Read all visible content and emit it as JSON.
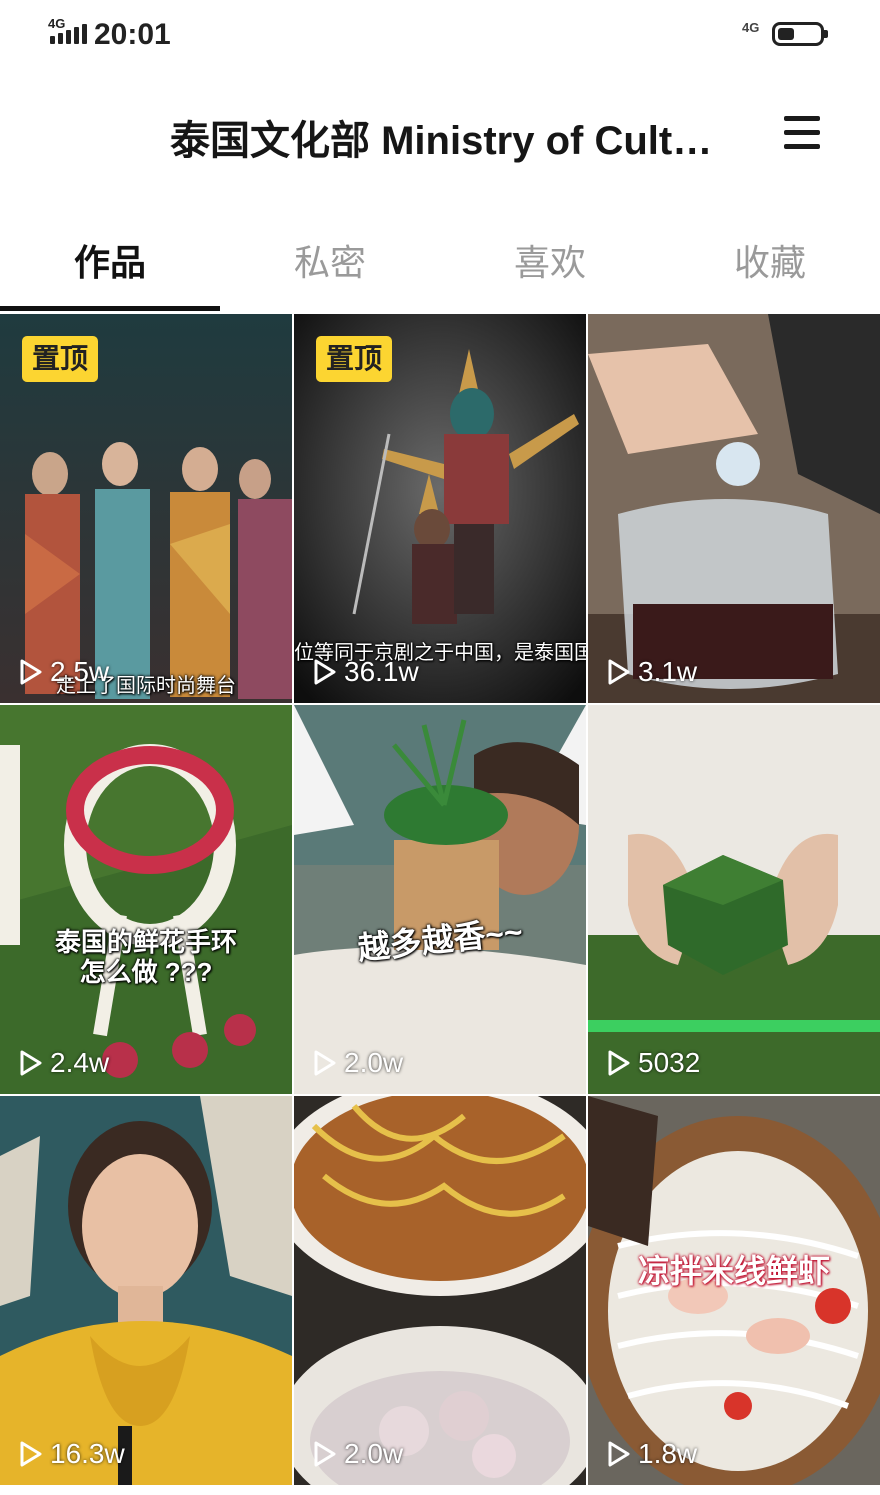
{
  "status_bar": {
    "network_left": "4G",
    "time": "20:01",
    "network_right": "4G",
    "battery_level_percent": 40
  },
  "header": {
    "title": "泰国文化部 Ministry of Cult…",
    "menu_icon": "hamburger-menu-icon"
  },
  "tabs": [
    {
      "label": "作品",
      "active": true
    },
    {
      "label": "私密",
      "active": false
    },
    {
      "label": "喜欢",
      "active": false
    },
    {
      "label": "收藏",
      "active": false
    }
  ],
  "videos": [
    {
      "pinned": "置顶",
      "views": "2.5w",
      "caption": "走上了国际时尚舞台",
      "scene": "fashion runway models"
    },
    {
      "pinned": "置顶",
      "views": "36.1w",
      "caption": "位等同于京剧之于中国，是泰国国",
      "scene": "khon masked dance"
    },
    {
      "views": "3.1w",
      "scene": "drink in plastic bag"
    },
    {
      "views": "2.4w",
      "caption": "泰国的鲜花手环\n怎么做 ???",
      "scene": "flower garland"
    },
    {
      "views": "2.0w",
      "caption": "越多越香~~",
      "scene": "woman holding plant pot"
    },
    {
      "views": "5032",
      "scene": "banana leaf folding"
    },
    {
      "views": "16.3w",
      "scene": "woman portrait"
    },
    {
      "views": "2.0w",
      "scene": "curry noodle soup"
    },
    {
      "views": "1.8w",
      "caption": "凉拌米线鲜虾",
      "scene": "rice noodle shrimp salad"
    }
  ],
  "icons": {
    "play": "play-icon"
  }
}
